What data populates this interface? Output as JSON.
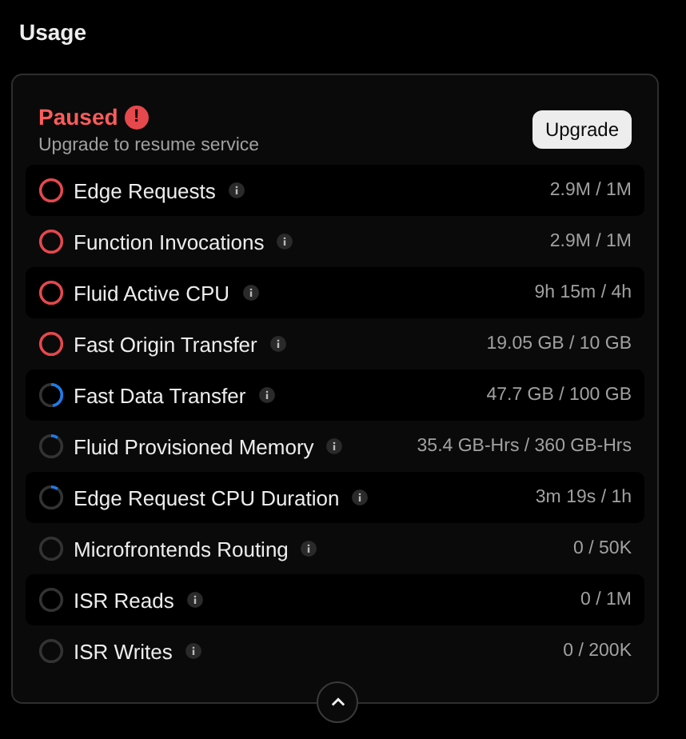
{
  "title": "Usage",
  "status": {
    "label": "Paused",
    "alert_icon": "!",
    "message": "Upgrade to resume service"
  },
  "upgrade_button": "Upgrade",
  "metrics": [
    {
      "name": "Edge Requests",
      "value": "2.9M / 1M",
      "kind": "over"
    },
    {
      "name": "Function Invocations",
      "value": "2.9M / 1M",
      "kind": "over"
    },
    {
      "name": "Fluid Active CPU",
      "value": "9h 15m / 4h",
      "kind": "over"
    },
    {
      "name": "Fast Origin Transfer",
      "value": "19.05 GB / 10 GB",
      "kind": "over"
    },
    {
      "name": "Fast Data Transfer",
      "value": "47.7 GB / 100 GB",
      "kind": "half"
    },
    {
      "name": "Fluid Provisioned Memory",
      "value": "35.4 GB-Hrs / 360 GB-Hrs",
      "kind": "low"
    },
    {
      "name": "Edge Request CPU Duration",
      "value": "3m 19s / 1h",
      "kind": "low"
    },
    {
      "name": "Microfrontends Routing",
      "value": "0 / 50K",
      "kind": "none"
    },
    {
      "name": "ISR Reads",
      "value": "0 / 1M",
      "kind": "none"
    },
    {
      "name": "ISR Writes",
      "value": "0 / 200K",
      "kind": "none"
    }
  ]
}
